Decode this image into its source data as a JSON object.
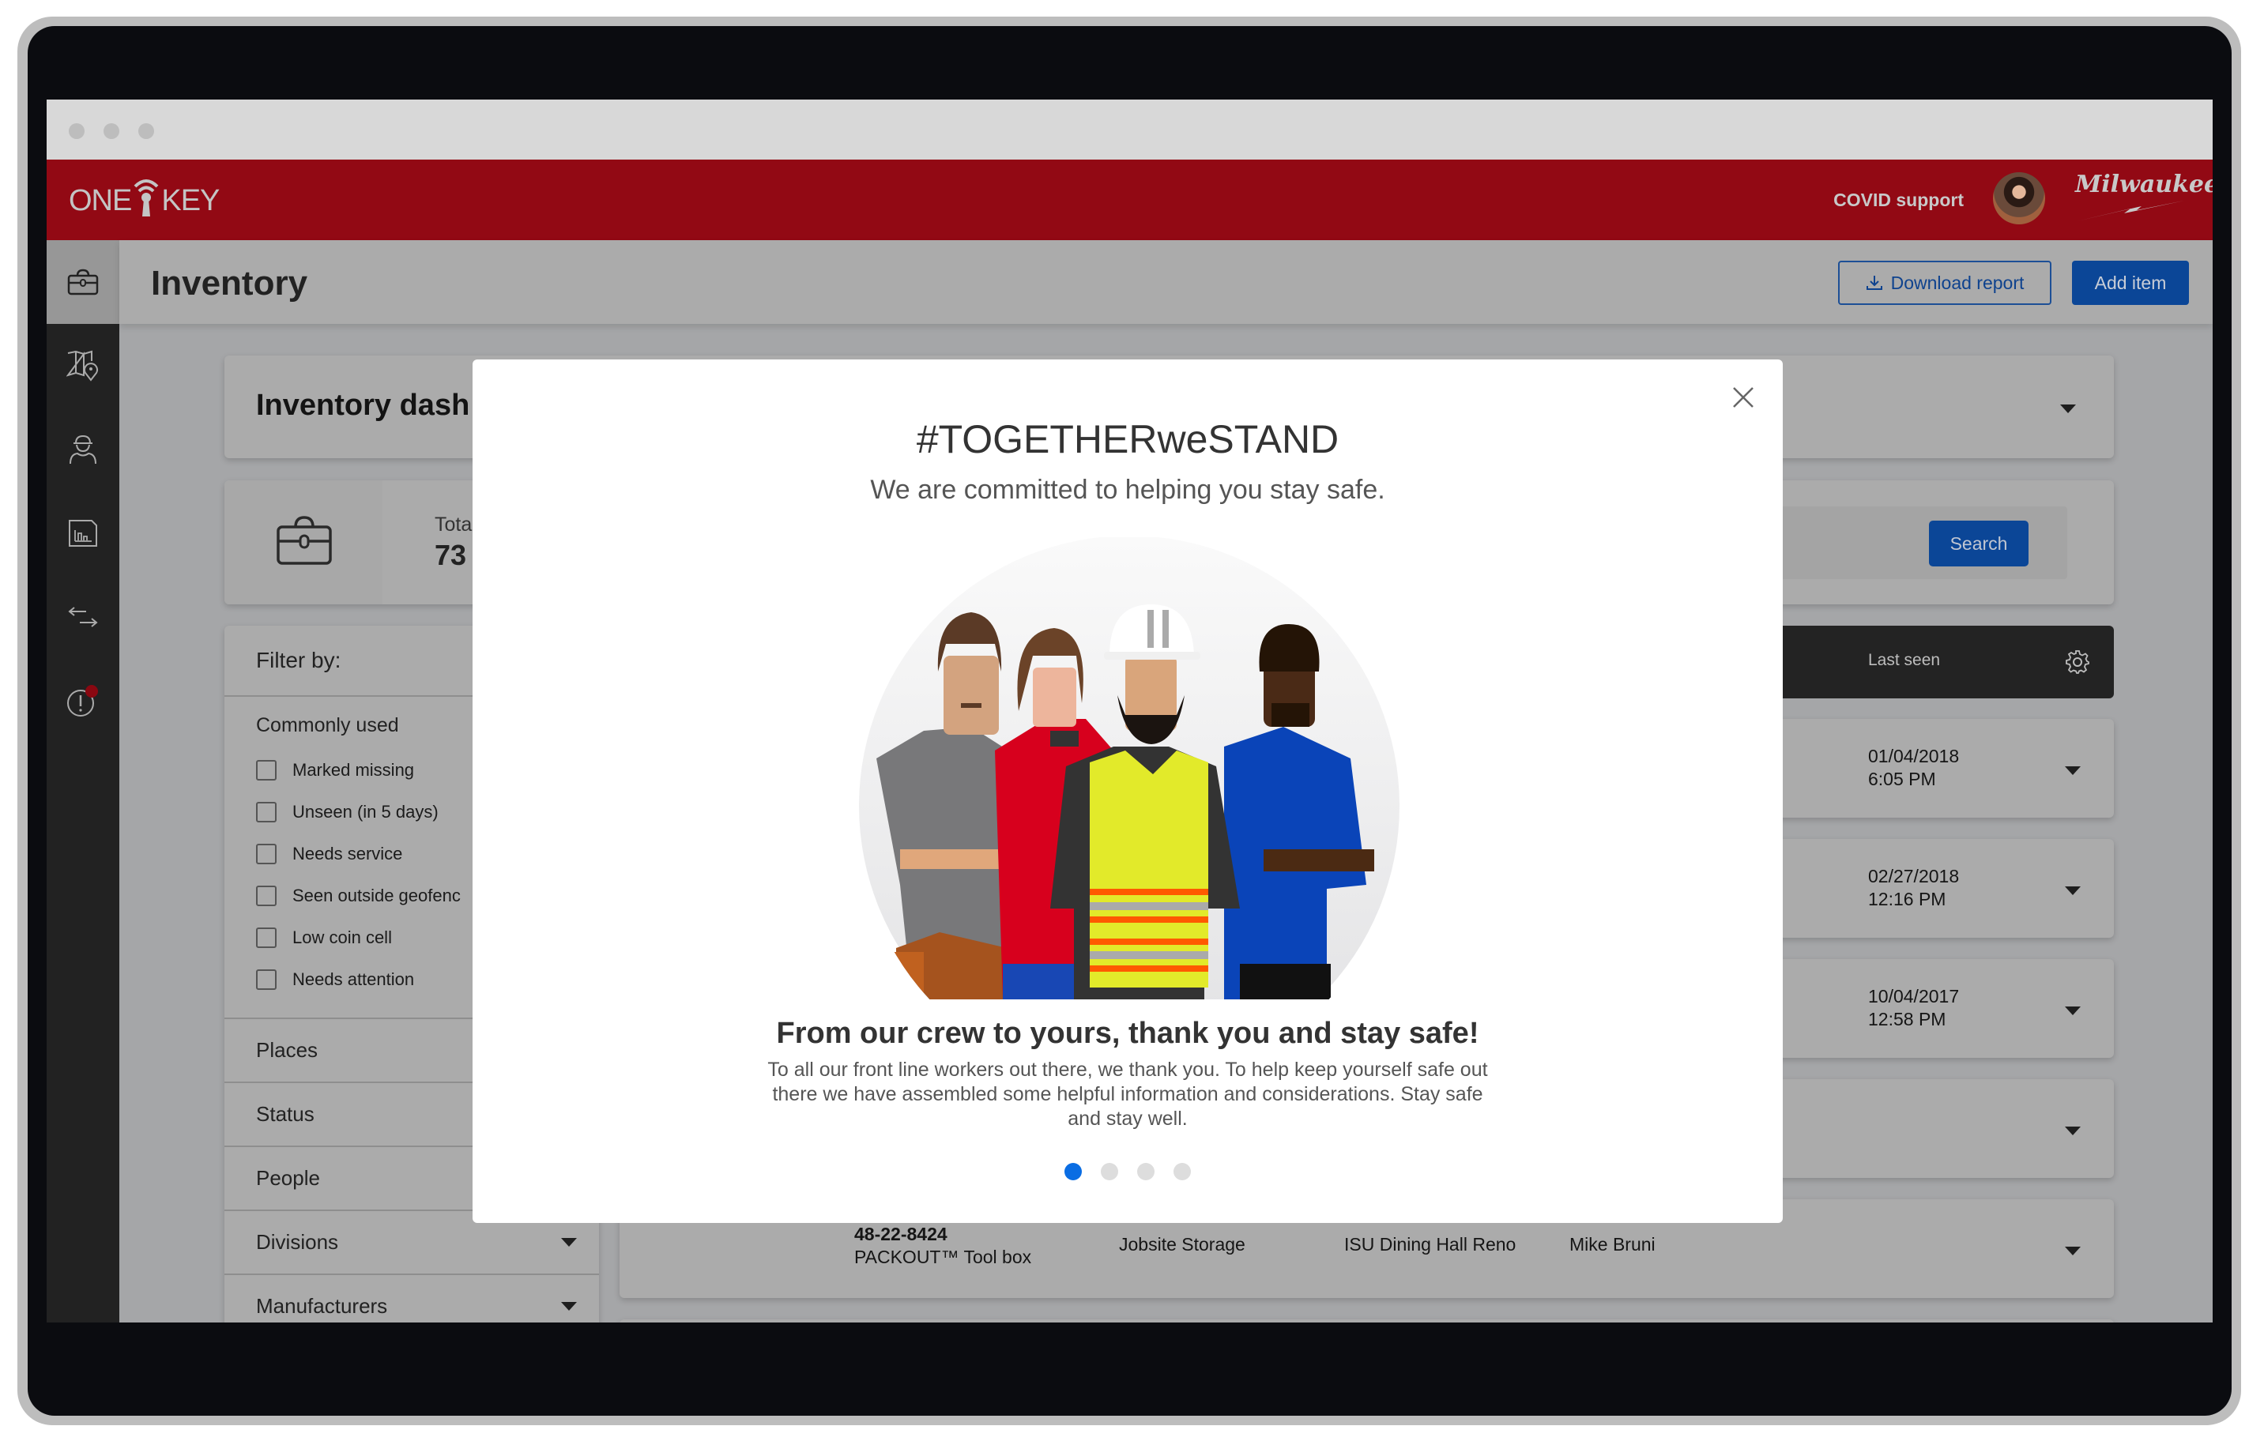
{
  "window": {
    "controls": [
      "close",
      "minimize",
      "maximize"
    ]
  },
  "topbar": {
    "logo": {
      "left": "ONE",
      "right": "KEY",
      "icon": "keyhole-signal-icon"
    },
    "covid_link": "COVID support",
    "avatar_icon": "user-avatar",
    "brand": "Milwaukee",
    "color": "#920914"
  },
  "sidebar": {
    "items": [
      {
        "name": "inventory",
        "icon": "toolbox-icon",
        "active": true
      },
      {
        "name": "map",
        "icon": "map-pin-icon",
        "active": false
      },
      {
        "name": "people",
        "icon": "worker-icon",
        "active": false
      },
      {
        "name": "reports",
        "icon": "chart-report-icon",
        "active": false
      },
      {
        "name": "transfers",
        "icon": "transfer-arrows-icon",
        "active": false
      },
      {
        "name": "alerts",
        "icon": "alert-circle-icon",
        "active": false,
        "badge": true
      }
    ]
  },
  "page": {
    "title": "Inventory",
    "download_button": "Download report",
    "add_button": "Add item"
  },
  "dashboard": {
    "title": "Inventory dash",
    "stats": {
      "label": "Tota",
      "value": "73",
      "icon": "toolbox-icon"
    },
    "search_button": "Search"
  },
  "filters": {
    "heading": "Filter by:",
    "commonly_used_label": "Commonly used",
    "checkboxes": [
      {
        "label": "Marked missing",
        "checked": false
      },
      {
        "label": "Unseen (in 5 days)",
        "checked": false
      },
      {
        "label": "Needs service",
        "checked": false
      },
      {
        "label": "Seen outside geofenc",
        "checked": false
      },
      {
        "label": "Low coin cell",
        "checked": false
      },
      {
        "label": "Needs attention",
        "checked": false
      }
    ],
    "facets": [
      {
        "label": "Places"
      },
      {
        "label": "Status"
      },
      {
        "label": "People"
      },
      {
        "label": "Divisions"
      },
      {
        "label": "Manufacturers"
      }
    ]
  },
  "table": {
    "header": {
      "last_seen": "Last seen",
      "settings_icon": "gear-icon"
    },
    "rows": [
      {
        "date": "01/04/2018",
        "time": "6:05 PM"
      },
      {
        "date": "02/27/2018",
        "time": "12:16 PM"
      },
      {
        "date": "10/04/2017",
        "time": "12:58 PM"
      },
      {
        "date": "",
        "time": ""
      },
      {
        "model": "48-22-8424",
        "name": "PACKOUT™ Tool box",
        "place": "Jobsite Storage",
        "division": "ISU Dining Hall Reno",
        "person": "Mike Bruni"
      }
    ]
  },
  "modal": {
    "title": "#TOGETHERweSTAND",
    "subtitle": "We are committed to helping you stay safe.",
    "heading": "From our crew to yours, thank you and stay safe!",
    "body": "To all our front line workers out there, we thank you. To help keep yourself safe out there we have assembled some helpful information and considerations. Stay safe and stay well.",
    "illustration": "four-workers-illustration",
    "pager": {
      "total": 4,
      "active": 1
    },
    "accent": "#0a6de3"
  }
}
